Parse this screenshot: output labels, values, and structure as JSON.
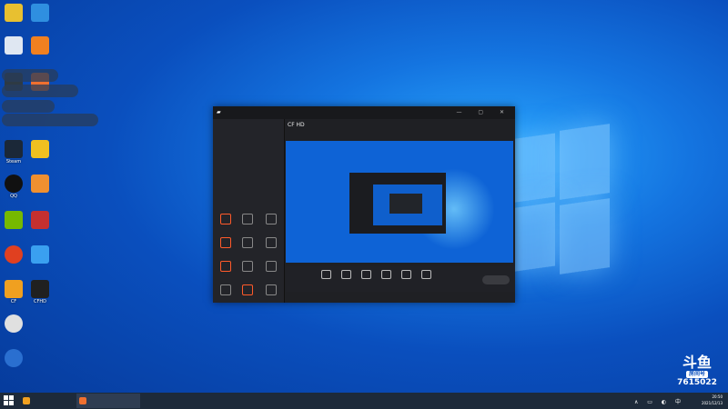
{
  "desktop": {
    "icons": [
      {
        "label": "",
        "color": "#e8c030"
      },
      {
        "label": "",
        "color": "#2f8fe0"
      },
      {
        "label": "",
        "color": "#dfe7f2"
      },
      {
        "label": "",
        "color": "#f08020"
      },
      {
        "label": "",
        "color": "#2e3a44"
      },
      {
        "label": "",
        "color": "#f07030"
      },
      {
        "label": "Steam",
        "color": "#1b2838"
      },
      {
        "label": "",
        "color": "#f0c020"
      },
      {
        "label": "QQ",
        "color": "#111111"
      },
      {
        "label": "",
        "color": "#f09030"
      },
      {
        "label": "",
        "color": "#76b900"
      },
      {
        "label": "",
        "color": "#c43030"
      },
      {
        "label": "",
        "color": "#e04020"
      },
      {
        "label": "",
        "color": "#3aa0f0"
      },
      {
        "label": "CF",
        "color": "#f0a020"
      },
      {
        "label": "CFHD",
        "color": "#202020"
      },
      {
        "label": "",
        "color": "#e0e0e0"
      },
      {
        "label": "",
        "color": "#2a6fd0"
      }
    ],
    "toasts": [
      "",
      "",
      "",
      ""
    ]
  },
  "app": {
    "badge": "",
    "window_controls": "— ▢ ✕",
    "left_tabs": [
      "",
      "",
      ""
    ],
    "tools_label": "",
    "tools": [
      "",
      "",
      "",
      "",
      "",
      "",
      "",
      "",
      "",
      "",
      "",
      ""
    ],
    "scene_title": "CF HD",
    "scene_meta": "",
    "footer_note": "",
    "bottom_bar": [
      "",
      "",
      "",
      "",
      "",
      ""
    ],
    "start_button": "",
    "status_strip": ""
  },
  "watermark": {
    "logo": "斗鱼",
    "tag": "房间号",
    "room_number": "7615022"
  },
  "taskbar": {
    "apps": [
      {
        "label": "",
        "color": "#f0a020"
      },
      {
        "label": "",
        "color": "#f07030"
      }
    ],
    "tray_icons": "∧ ▭ ◐ 中",
    "time": "20:50",
    "date": "2021/12/13"
  },
  "colors": {
    "desktop_blue": "#1474e0",
    "app_background": "#1f2024",
    "accent": "#ff6a3d"
  }
}
